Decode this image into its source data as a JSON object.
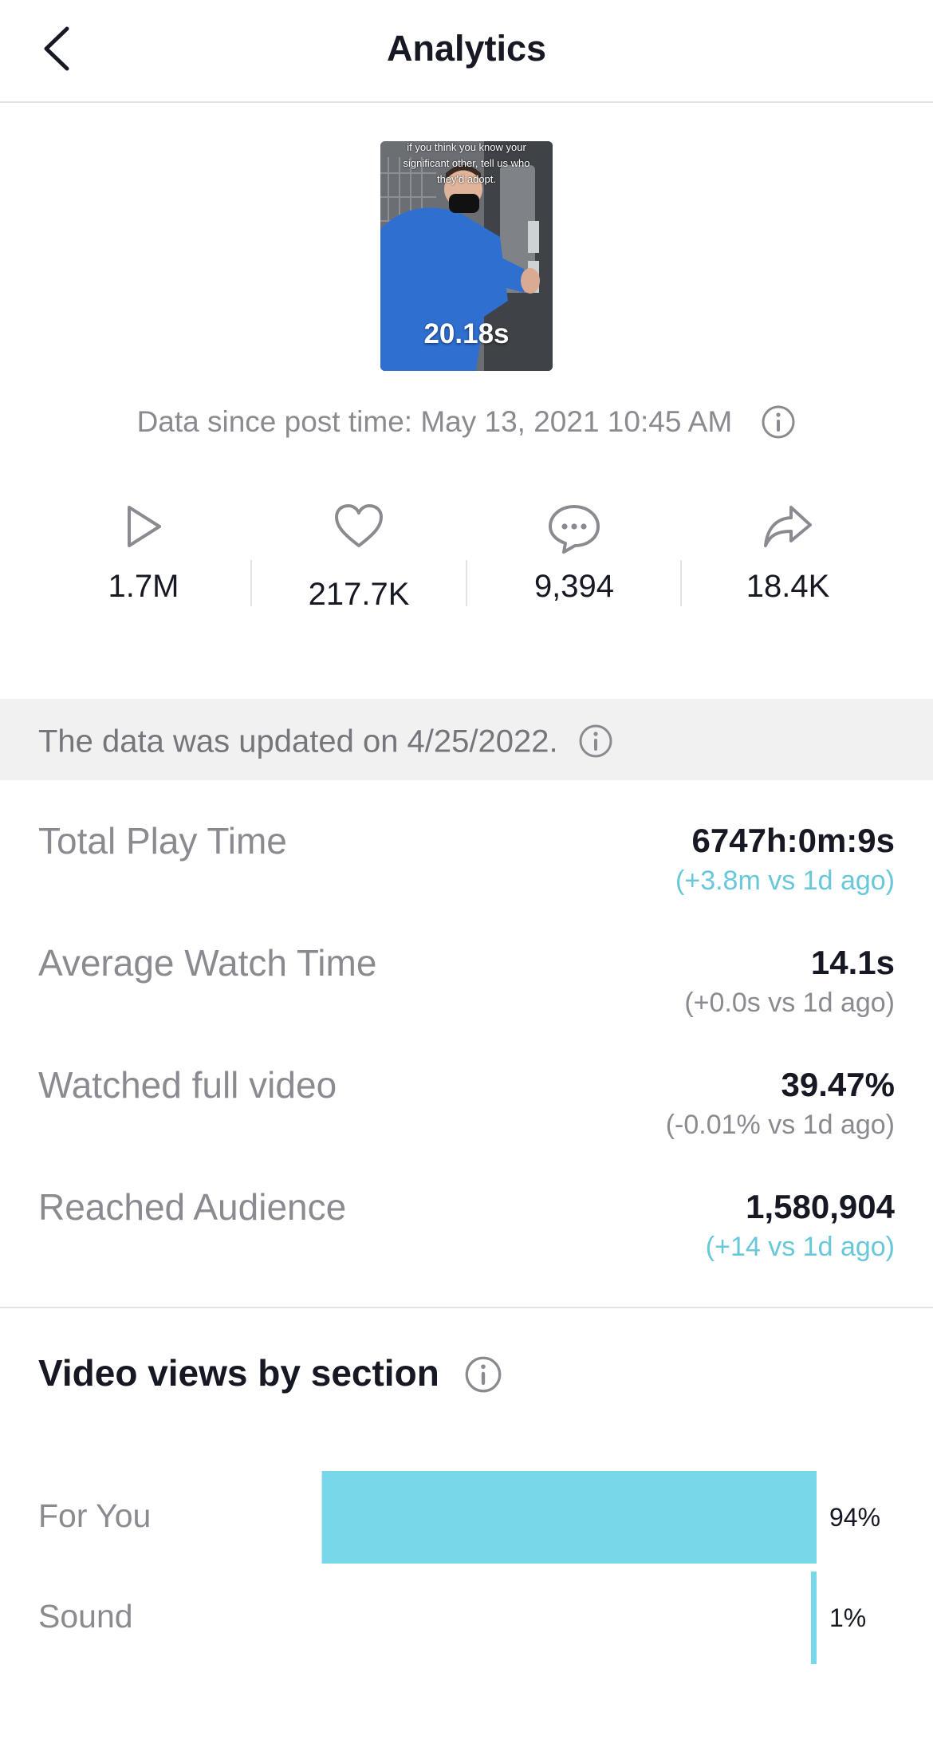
{
  "header": {
    "title": "Analytics",
    "back_icon": "chevron-left-icon"
  },
  "video": {
    "caption": "if you think you know your significant other, tell us who they'd adopt.",
    "duration": "20.18s"
  },
  "post_time": {
    "text": "Data since post time: May 13, 2021 10:45 AM",
    "icon": "info-icon"
  },
  "stats": [
    {
      "icon": "play-icon",
      "value": "1.7M"
    },
    {
      "icon": "heart-icon",
      "value": "217.7K"
    },
    {
      "icon": "comment-icon",
      "value": "9,394"
    },
    {
      "icon": "share-icon",
      "value": "18.4K"
    }
  ],
  "banner": {
    "text": "The data was updated on 4/25/2022.",
    "icon": "info-icon"
  },
  "metrics": [
    {
      "label": "Total Play Time",
      "value": "6747h:0m:9s",
      "change": "(+3.8m vs 1d ago)",
      "change_color": "#68c8d9"
    },
    {
      "label": "Average Watch Time",
      "value": "14.1s",
      "change": "(+0.0s vs 1d ago)",
      "change_color": "#8a8b91"
    },
    {
      "label": "Watched full video",
      "value": "39.47%",
      "change": "(-0.01% vs 1d ago)",
      "change_color": "#8a8b91"
    },
    {
      "label": "Reached Audience",
      "value": "1,580,904",
      "change": "(+14 vs 1d ago)",
      "change_color": "#68c8d9"
    }
  ],
  "section": {
    "title": "Video views by section",
    "icon": "info-icon"
  },
  "chart_data": {
    "type": "bar",
    "orientation": "horizontal",
    "categories": [
      "For You",
      "Sound"
    ],
    "values": [
      94,
      1
    ],
    "value_labels": [
      "94%",
      "1%"
    ],
    "color": "#78d8ea"
  }
}
